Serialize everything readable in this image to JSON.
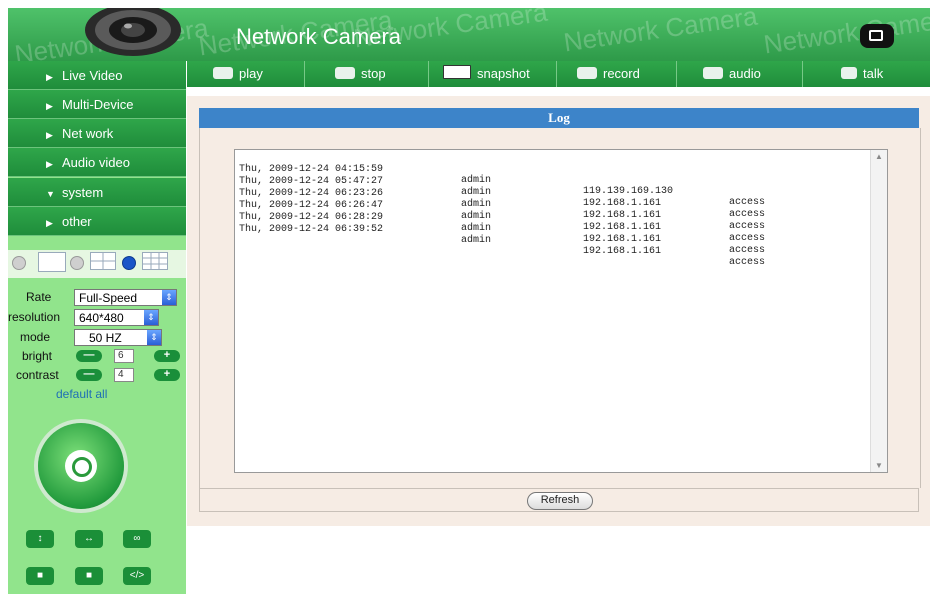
{
  "header": {
    "title": "Network Camera",
    "watermark": "Network Camera",
    "fullscreen_icon": "fullscreen-icon"
  },
  "sidebar": {
    "menu": [
      {
        "label": "Live Video",
        "state": "collapsed"
      },
      {
        "label": "Multi-Device",
        "state": "collapsed"
      },
      {
        "label": "Net work",
        "state": "collapsed"
      },
      {
        "label": "Audio video",
        "state": "collapsed"
      },
      {
        "label": "system",
        "state": "expanded"
      },
      {
        "label": "other",
        "state": "collapsed"
      }
    ],
    "controls": {
      "rate_label": "Rate",
      "rate_value": "Full-Speed",
      "resolution_label": "resolution",
      "resolution_value": "640*480",
      "mode_label": "mode",
      "mode_value": "50 HZ",
      "bright_label": "bright",
      "bright_value": "6",
      "contrast_label": "contrast",
      "contrast_value": "4",
      "default_all": "default all"
    }
  },
  "toolbar": {
    "items": [
      "play",
      "stop",
      "snapshot",
      "record",
      "audio",
      "talk"
    ]
  },
  "log": {
    "title": "Log",
    "rows": [
      {
        "datetime": "Thu, 2009-12-24 04:15:59",
        "user": "admin",
        "ip": "119.139.169.130",
        "action": "access"
      },
      {
        "datetime": "Thu, 2009-12-24 05:47:27",
        "user": "admin",
        "ip": "192.168.1.161",
        "action": "access"
      },
      {
        "datetime": "Thu, 2009-12-24 06:23:26",
        "user": "admin",
        "ip": "192.168.1.161",
        "action": "access"
      },
      {
        "datetime": "Thu, 2009-12-24 06:26:47",
        "user": "admin",
        "ip": "192.168.1.161",
        "action": "access"
      },
      {
        "datetime": "Thu, 2009-12-24 06:28:29",
        "user": "admin",
        "ip": "192.168.1.161",
        "action": "access"
      },
      {
        "datetime": "Thu, 2009-12-24 06:39:52",
        "user": "admin",
        "ip": "192.168.1.161",
        "action": "access"
      }
    ],
    "refresh_label": "Refresh"
  },
  "colors": {
    "brand_green": "#2e9a49",
    "sidebar_bg": "#91e48c",
    "log_header": "#3d84c9"
  }
}
